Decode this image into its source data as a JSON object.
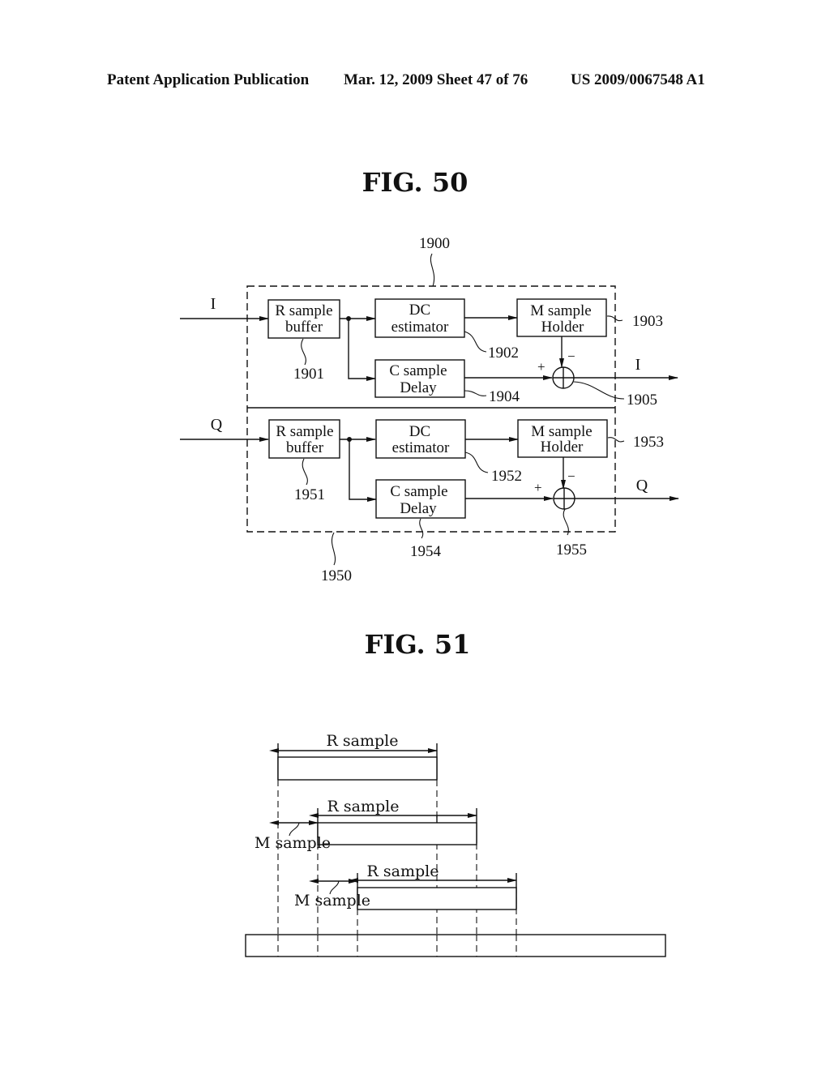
{
  "header": {
    "publication": "Patent Application Publication",
    "date_sheet": "Mar. 12, 2009  Sheet 47 of 76",
    "pub_number": "US 2009/0067548 A1"
  },
  "fig50": {
    "title": "FIG. 50",
    "outer_refs": {
      "top": "1900",
      "bottom": "1950"
    },
    "channels": [
      {
        "input_label": "I",
        "output_label": "I",
        "buffer": {
          "line1": "R sample",
          "line2": "buffer",
          "ref": "1901"
        },
        "estimator": {
          "line1": "DC",
          "line2": "estimator",
          "ref": "1902"
        },
        "holder": {
          "line1": "M sample",
          "line2": "Holder",
          "ref": "1903"
        },
        "delay": {
          "line1": "C sample",
          "line2": "Delay",
          "ref": "1904"
        },
        "adder": {
          "plus": "+",
          "minus": "−",
          "ref": "1905"
        }
      },
      {
        "input_label": "Q",
        "output_label": "Q",
        "buffer": {
          "line1": "R sample",
          "line2": "buffer",
          "ref": "1951"
        },
        "estimator": {
          "line1": "DC",
          "line2": "estimator",
          "ref": "1952"
        },
        "holder": {
          "line1": "M sample",
          "line2": "Holder",
          "ref": "1953"
        },
        "delay": {
          "line1": "C sample",
          "line2": "Delay",
          "ref": "1954"
        },
        "adder": {
          "plus": "+",
          "minus": "−",
          "ref": "1955"
        }
      }
    ]
  },
  "fig51": {
    "title": "FIG. 51",
    "windows": [
      {
        "r_label": "R sample"
      },
      {
        "r_label": "R sample",
        "m_label": "M sample"
      },
      {
        "r_label": "R sample",
        "m_label": "M sample"
      }
    ]
  }
}
